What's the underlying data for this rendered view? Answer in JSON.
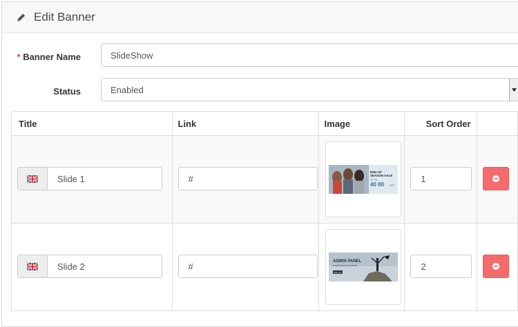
{
  "heading": {
    "title": "Edit Banner",
    "icon": "pencil-icon"
  },
  "form": {
    "banner_name_label": "Banner Name",
    "required_mark": "*",
    "banner_name_value": "SlideShow",
    "status_label": "Status",
    "status_value": "Enabled"
  },
  "table": {
    "headers": {
      "title": "Title",
      "link": "Link",
      "image": "Image",
      "sort_order": "Sort Order"
    },
    "rows": [
      {
        "title": "Slide 1",
        "link": "#",
        "sort_order": "1",
        "image": {
          "line1": "END OF",
          "line2": "SEASON SALE",
          "line3": "UP TO",
          "line4": "40 80",
          "line5": "OFF"
        }
      },
      {
        "title": "Slide 2",
        "link": "#",
        "sort_order": "2",
        "image": {
          "line1": "ADMIN PANEL",
          "line2": "LOREM IPSUM DOLOR SIT",
          "line3": "shop now"
        }
      }
    ]
  },
  "colors": {
    "remove_button": "#f56b6b",
    "required": "#e3503e"
  },
  "icons": {
    "language_flag": "uk-flag-icon",
    "remove": "minus-circle-icon",
    "select": "caret-down-icon"
  }
}
